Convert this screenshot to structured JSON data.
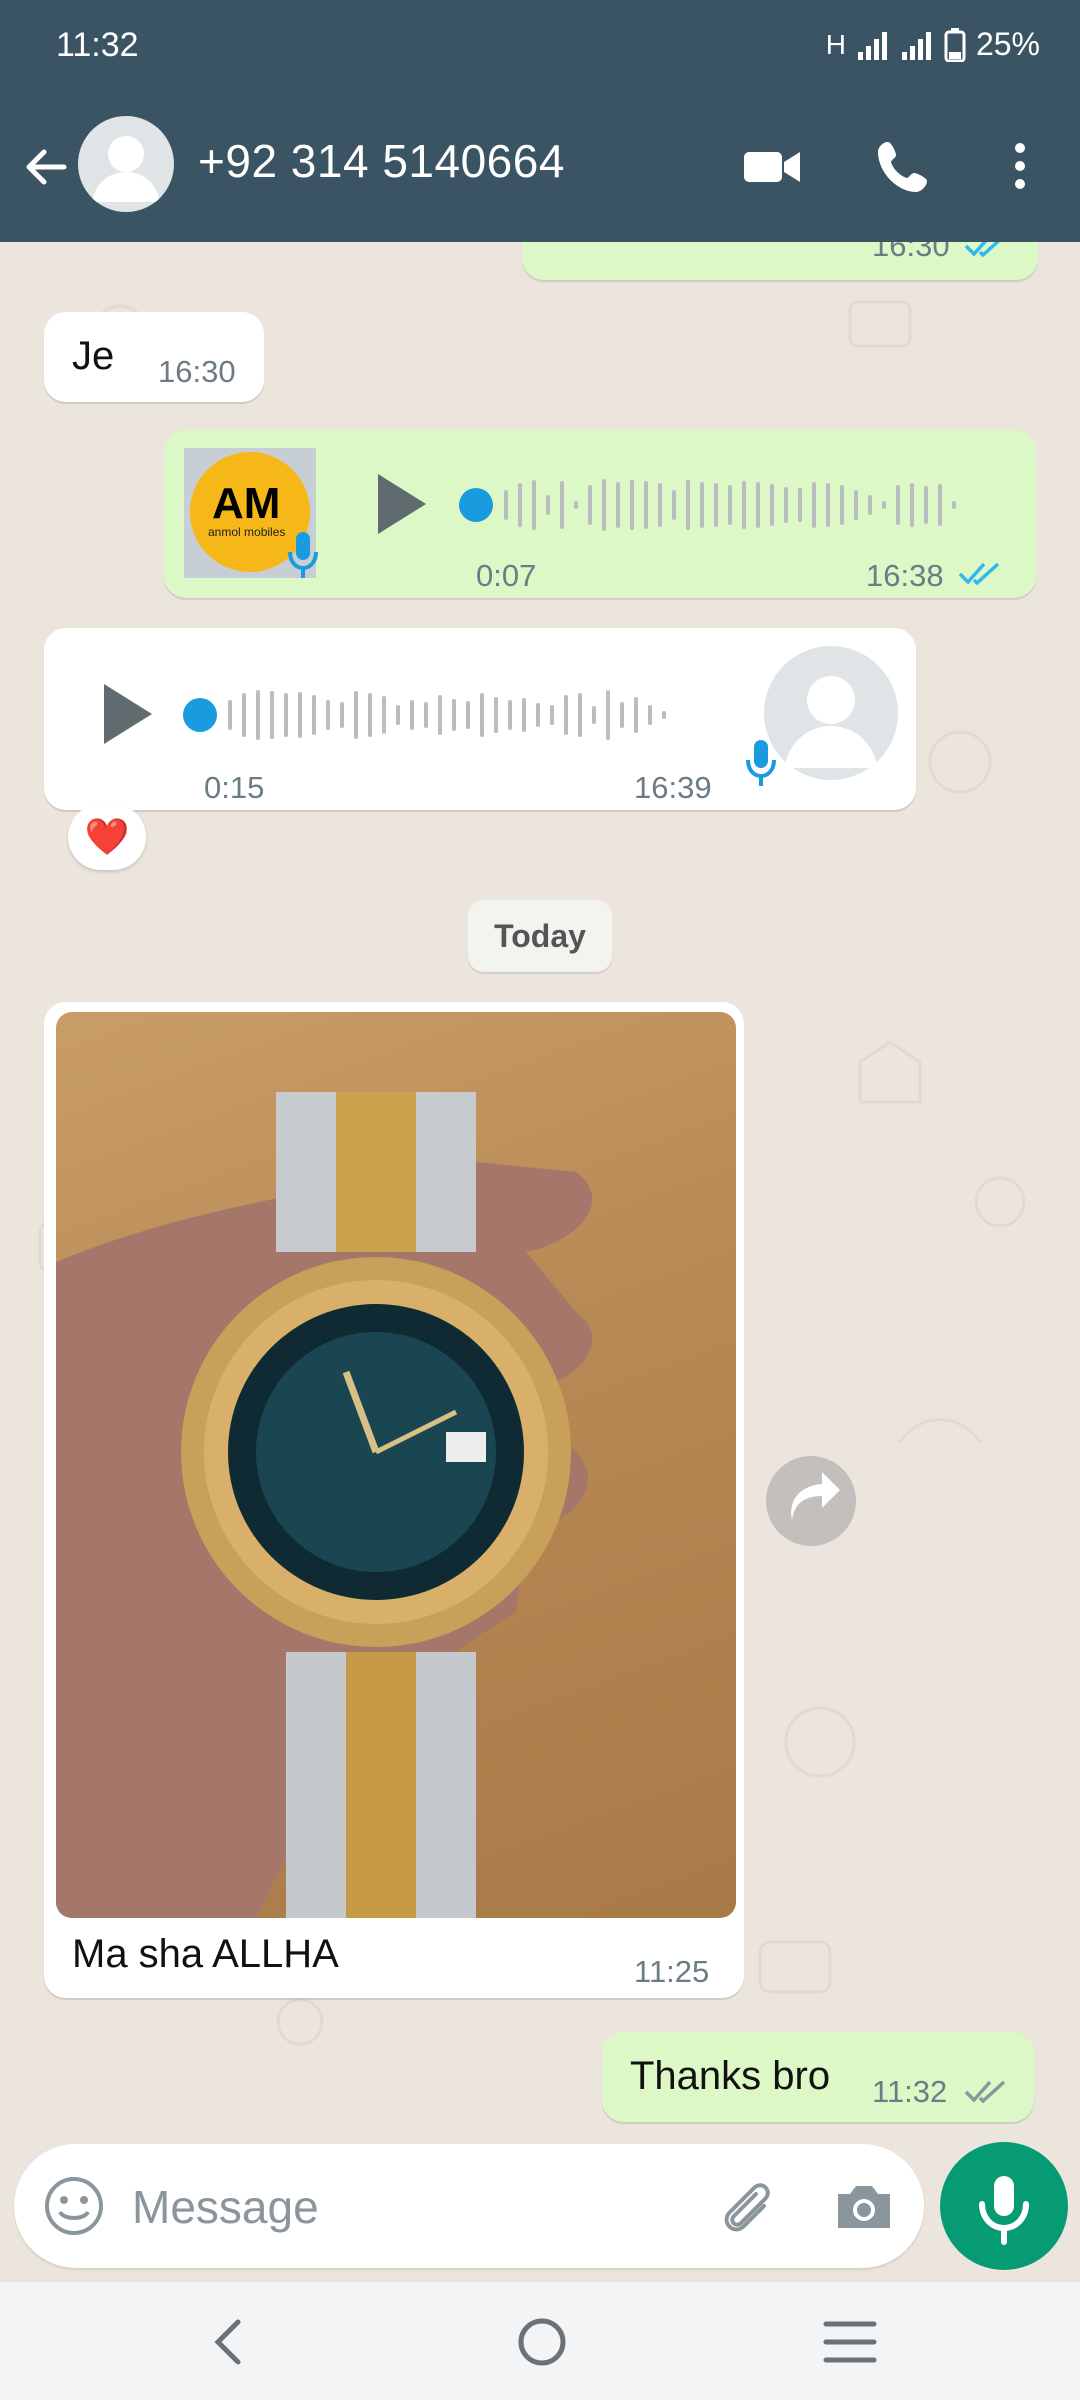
{
  "status_bar": {
    "time": "11:32",
    "network": "H",
    "battery": "25%"
  },
  "header": {
    "contact_name": "+92 314 5140664",
    "icons": [
      "back-arrow-icon",
      "avatar",
      "video-call-icon",
      "voice-call-icon",
      "more-options-icon"
    ]
  },
  "messages": {
    "partial_top": {
      "time": "16:30",
      "status": "read"
    },
    "je": {
      "text": "Je",
      "time": "16:30"
    },
    "voice_out": {
      "duration": "0:07",
      "time": "16:38",
      "status": "read",
      "avatar_text": "anmol mobiles"
    },
    "voice_in": {
      "duration": "0:15",
      "time": "16:39",
      "reaction": "❤️"
    },
    "date_separator": "Today",
    "image_msg": {
      "caption": "Ma sha ALLHA",
      "time": "11:25"
    },
    "thanks": {
      "text": "Thanks bro",
      "time": "11:32",
      "status": "delivered"
    }
  },
  "input": {
    "placeholder": "Message"
  },
  "colors": {
    "header": "#3b5463",
    "outgoing_bubble": "#dcf8c6",
    "incoming_bubble": "#ffffff",
    "chat_bg": "#ece5dd",
    "accent_green": "#079b74",
    "read_tick": "#34b7f1",
    "voice_dot": "#1a9be0"
  }
}
